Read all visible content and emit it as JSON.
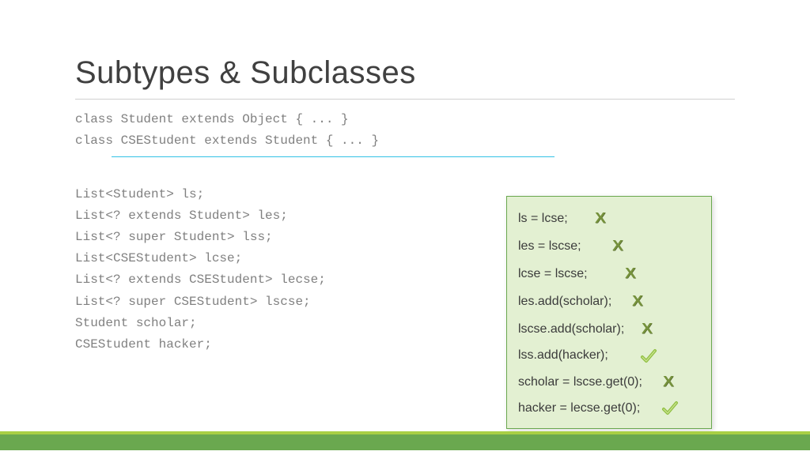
{
  "title": "Subtypes & Subclasses",
  "code": {
    "line1": "class Student extends Object { ... }",
    "line2": "class CSEStudent extends Student { ... }",
    "decl1": "List<Student> ls;",
    "decl2": "List<? extends Student> les;",
    "decl3": "List<? super Student> lss;",
    "decl4": "List<CSEStudent> lcse;",
    "decl5": "List<? extends CSEStudent> lecse;",
    "decl6": "List<? super CSEStudent> lscse;",
    "decl7": "Student scholar;",
    "decl8": "CSEStudent hacker;"
  },
  "callout": [
    {
      "text": "ls = lcse;        ",
      "mark": "x"
    },
    {
      "text": "les = lscse;         ",
      "mark": "x"
    },
    {
      "text": "lcse = lscse;           ",
      "mark": "x"
    },
    {
      "text": "les.add(scholar);      ",
      "mark": "x"
    },
    {
      "text": "lscse.add(scholar);     ",
      "mark": "x"
    },
    {
      "text": "lss.add(hacker);         ",
      "mark": "check"
    },
    {
      "text": "scholar = lscse.get(0);      ",
      "mark": "x"
    },
    {
      "text": "hacker = lecse.get(0);      ",
      "mark": "check"
    }
  ],
  "marks": {
    "x": "X"
  }
}
